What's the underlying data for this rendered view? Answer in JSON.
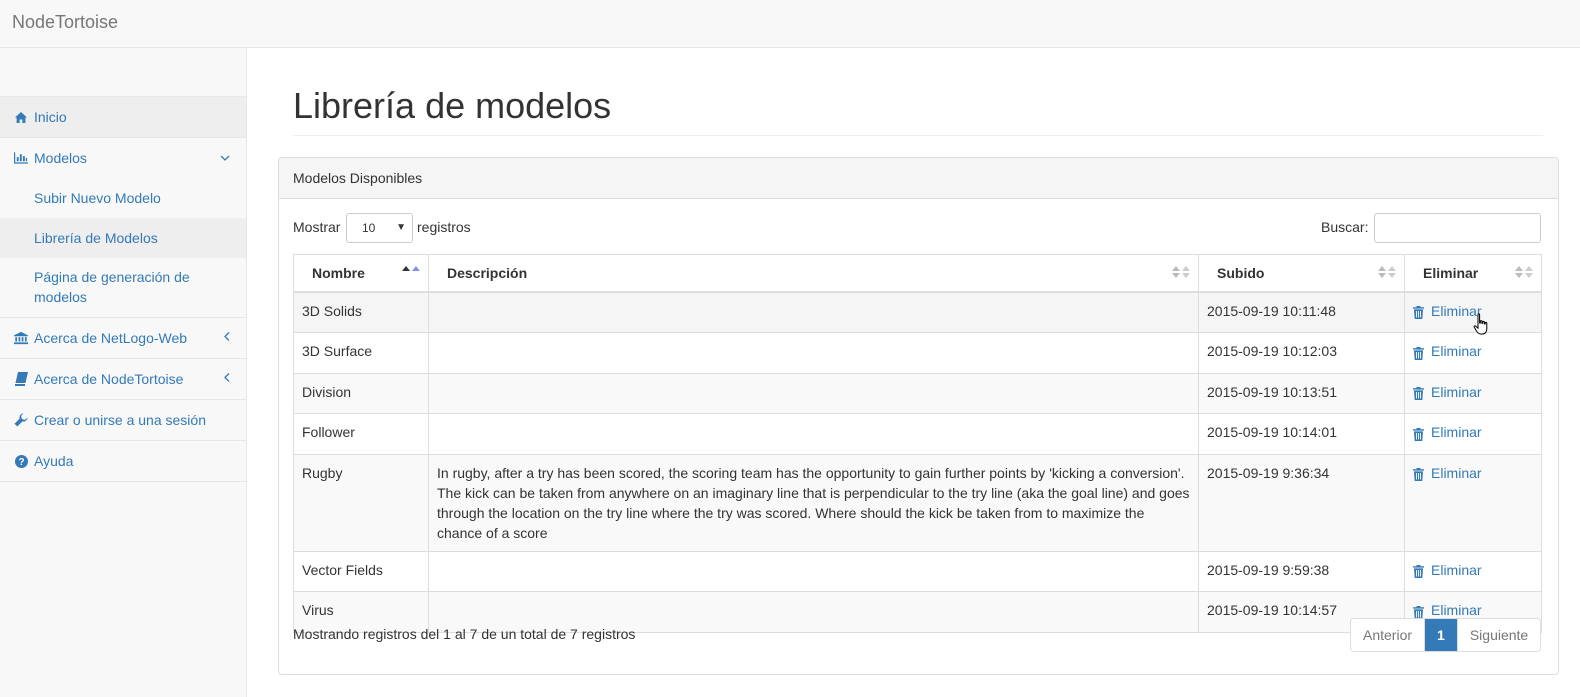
{
  "navbar": {
    "brand": "NodeTortoise"
  },
  "sidebar": {
    "items": [
      {
        "label": "Inicio",
        "icon": "home-icon"
      },
      {
        "label": "Modelos",
        "icon": "bar-chart-icon",
        "arrow": "chevron-down-icon",
        "children": [
          {
            "label": "Subir Nuevo Modelo"
          },
          {
            "label": "Librería de Modelos",
            "active": true
          },
          {
            "label": "Página de generación de modelos"
          }
        ]
      },
      {
        "label": "Acerca de NetLogo-Web",
        "icon": "bank-icon",
        "arrow": "chevron-left-icon"
      },
      {
        "label": "Acerca de NodeTortoise",
        "icon": "book-icon",
        "arrow": "chevron-left-icon"
      },
      {
        "label": "Crear o unirse a una sesión",
        "icon": "wrench-icon"
      },
      {
        "label": "Ayuda",
        "icon": "question-circle-icon"
      }
    ]
  },
  "page": {
    "title": "Librería de modelos"
  },
  "panel": {
    "heading": "Modelos Disponibles",
    "length": {
      "prefix": "Mostrar",
      "value": "10",
      "suffix": "registros"
    },
    "search": {
      "label": "Buscar:",
      "value": ""
    },
    "columns": [
      "Nombre",
      "Descripción",
      "Subido",
      "Eliminar"
    ],
    "rows": [
      {
        "name": "3D Solids",
        "description": "",
        "uploaded": "2015-09-19 10:11:48",
        "action": "Eliminar"
      },
      {
        "name": "3D Surface",
        "description": "",
        "uploaded": "2015-09-19 10:12:03",
        "action": "Eliminar"
      },
      {
        "name": "Division",
        "description": "",
        "uploaded": "2015-09-19 10:13:51",
        "action": "Eliminar"
      },
      {
        "name": "Follower",
        "description": "",
        "uploaded": "2015-09-19 10:14:01",
        "action": "Eliminar"
      },
      {
        "name": "Rugby",
        "description": "In rugby, after a try has been scored, the scoring team has the opportunity to gain further points by 'kicking a conversion'. The kick can be taken from anywhere on an imaginary line that is perpendicular to the try line (aka the goal line) and goes through the location on the try line where the try was scored. Where should the kick be taken from to maximize the chance of a score",
        "uploaded": "2015-09-19 9:36:34",
        "action": "Eliminar"
      },
      {
        "name": "Vector Fields",
        "description": "",
        "uploaded": "2015-09-19 9:59:38",
        "action": "Eliminar"
      },
      {
        "name": "Virus",
        "description": "",
        "uploaded": "2015-09-19 10:14:57",
        "action": "Eliminar"
      }
    ],
    "info": "Mostrando registros del 1 al 7 de un total de 7 registros",
    "pagination": {
      "prev": "Anterior",
      "current": "1",
      "next": "Siguiente"
    }
  },
  "colors": {
    "link": "#337ab7",
    "active_page": "#337ab7",
    "sidebar_bg": "#f8f8f8"
  }
}
